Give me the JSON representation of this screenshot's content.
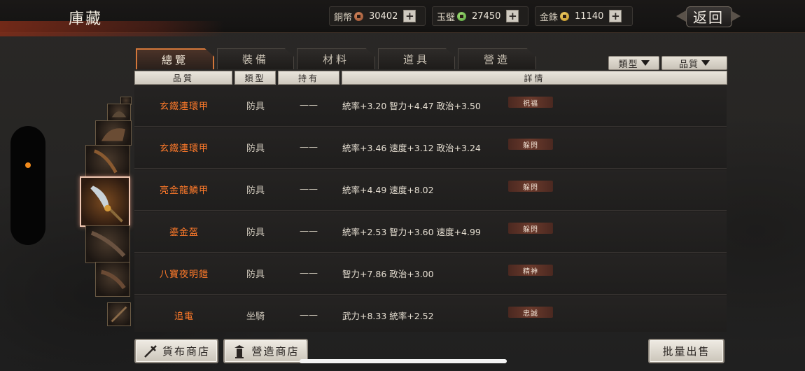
{
  "header": {
    "title": "庫藏",
    "back_label": "返回"
  },
  "currencies": [
    {
      "label": "銅幣",
      "value": "30402",
      "icon": "copper-coin-icon",
      "color": "#c0704a"
    },
    {
      "label": "玉璧",
      "value": "27450",
      "icon": "jade-coin-icon",
      "color": "#6dbf4b"
    },
    {
      "label": "金銖",
      "value": "11140",
      "icon": "gold-coin-icon",
      "color": "#e0b640"
    }
  ],
  "tabs": [
    {
      "label": "總覽",
      "active": true
    },
    {
      "label": "裝備",
      "active": false
    },
    {
      "label": "材料",
      "active": false
    },
    {
      "label": "道具",
      "active": false
    },
    {
      "label": "營造",
      "active": false
    }
  ],
  "filters": {
    "type_label": "類型",
    "quality_label": "品質"
  },
  "table": {
    "headers": [
      "品質",
      "類型",
      "持有",
      "詳情"
    ],
    "rows": [
      {
        "name": "玄鐵連環甲",
        "type": "防具",
        "owned": "——",
        "detail": "統率+3.20  智力+4.47  政治+3.50",
        "trait": "祝福"
      },
      {
        "name": "玄鐵連環甲",
        "type": "防具",
        "owned": "——",
        "detail": "統率+3.46  速度+3.12  政治+3.24",
        "trait": "躲閃"
      },
      {
        "name": "亮金龍鱗甲",
        "type": "防具",
        "owned": "——",
        "detail": "統率+4.49  速度+8.02",
        "trait": "躲閃"
      },
      {
        "name": "鎏金盔",
        "type": "防具",
        "owned": "——",
        "detail": "統率+2.53  智力+3.60  速度+4.99",
        "trait": "躲閃"
      },
      {
        "name": "八寶夜明鎧",
        "type": "防具",
        "owned": "——",
        "detail": "智力+7.86  政治+3.00",
        "trait": "精神"
      },
      {
        "name": "追電",
        "type": "坐騎",
        "owned": "——",
        "detail": "武力+8.33  統率+2.52",
        "trait": "忠誠"
      }
    ]
  },
  "bottom": {
    "currency_shop": "貨布商店",
    "build_shop": "營造商店",
    "bulk_sell": "批量出售"
  },
  "colors": {
    "accent_orange": "#ff7a2a",
    "active_tab_border": "#d3773a",
    "slider_dot": "#f08a1c"
  }
}
